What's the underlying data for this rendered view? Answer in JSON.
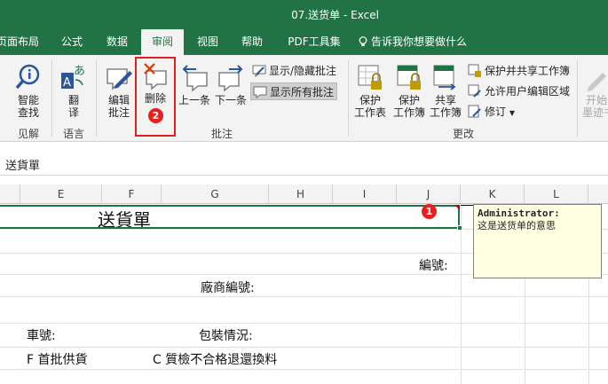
{
  "window": {
    "title": "07.送货单  -  Excel"
  },
  "tabs": [
    {
      "label": "页面布局",
      "active": false
    },
    {
      "label": "公式",
      "active": false
    },
    {
      "label": "数据",
      "active": false
    },
    {
      "label": "审阅",
      "active": true
    },
    {
      "label": "视图",
      "active": false
    },
    {
      "label": "帮助",
      "active": false
    },
    {
      "label": "PDF工具集",
      "active": false
    }
  ],
  "tell_me": {
    "label": "告诉我你想要做什么",
    "icon": "lightbulb-icon"
  },
  "ribbon": {
    "proofing": {
      "group_label": "见解",
      "smart_lookup": "智能\n查找"
    },
    "language": {
      "group_label": "语言",
      "translate": "翻\n译"
    },
    "comments": {
      "group_label": "批注",
      "edit_comment": "编辑\n批注",
      "delete": "删除",
      "previous": "上一条",
      "next": "下一条",
      "show_hide": "显示/隐藏批注",
      "show_all": "显示所有批注"
    },
    "changes": {
      "group_label": "更改",
      "protect_sheet": "保护\n工作表",
      "protect_workbook": "保护\n工作簿",
      "share_workbook": "共享\n工作簿",
      "protect_share": "保护并共享工作簿",
      "allow_edit_ranges": "允许用户编辑区域",
      "track_changes": "修订"
    },
    "ink": {
      "label": "开始\n墨迹书"
    }
  },
  "annotations": {
    "step1": "1",
    "step2": "2"
  },
  "formula_bar": {
    "content": "送貨單"
  },
  "columns": [
    "E",
    "F",
    "G",
    "H",
    "I",
    "J",
    "K",
    "L"
  ],
  "cells": {
    "title": "送貨單",
    "number_label": "編號:",
    "vendor_code_label": "廠商編號:",
    "vehicle_label": "車號:",
    "packaging_label": "包裝情況:",
    "note_f": "F  首批供貨",
    "note_c": "C  質檢不合格退還換料"
  },
  "comment": {
    "author": "Administrator:",
    "text": "这是送货单的意思"
  },
  "colors": {
    "excel_green": "#217346",
    "highlight_red": "#e02020",
    "comment_bg": "#ffffe1"
  }
}
